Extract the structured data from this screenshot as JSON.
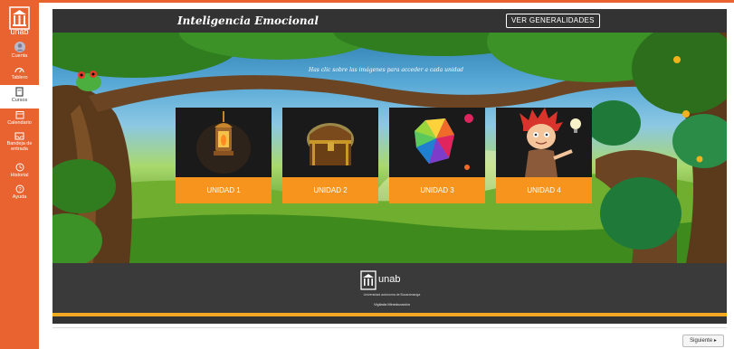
{
  "nav": {
    "logo_text": "unab",
    "items": [
      {
        "label": "Cuenta",
        "icon": "user-avatar-icon"
      },
      {
        "label": "Tablero",
        "icon": "dashboard-icon"
      },
      {
        "label": "Cursos",
        "icon": "book-icon"
      },
      {
        "label": "Calendario",
        "icon": "calendar-icon"
      },
      {
        "label": "Bandeja de entrada",
        "icon": "inbox-icon"
      },
      {
        "label": "Historial",
        "icon": "clock-icon"
      },
      {
        "label": "Ayuda",
        "icon": "help-icon"
      }
    ]
  },
  "course": {
    "title": "Inteligencia Emocional",
    "ver_button": "VER GENERALIDADES",
    "instruction": "Has clic sobre las imágenes para acceder a cada unidad",
    "units": [
      {
        "label": "UNIDAD 1",
        "icon": "lamp-icon"
      },
      {
        "label": "UNIDAD 2",
        "icon": "treasure-chest-icon"
      },
      {
        "label": "UNIDAD 3",
        "icon": "polyhedron-icon"
      },
      {
        "label": "UNIDAD 4",
        "icon": "idea-character-icon"
      }
    ],
    "footer": {
      "logo_name": "unab",
      "logo_sub": "Universidad autónoma de Bucaramanga",
      "vigilada": "Vigilada Mineducación"
    }
  },
  "pager": {
    "next_label": "Siguiente ▸"
  },
  "colors": {
    "brand_orange": "#e8632f",
    "unit_button": "#f7941d",
    "panel_dark": "#333333",
    "footer_line": "#f5a623"
  }
}
